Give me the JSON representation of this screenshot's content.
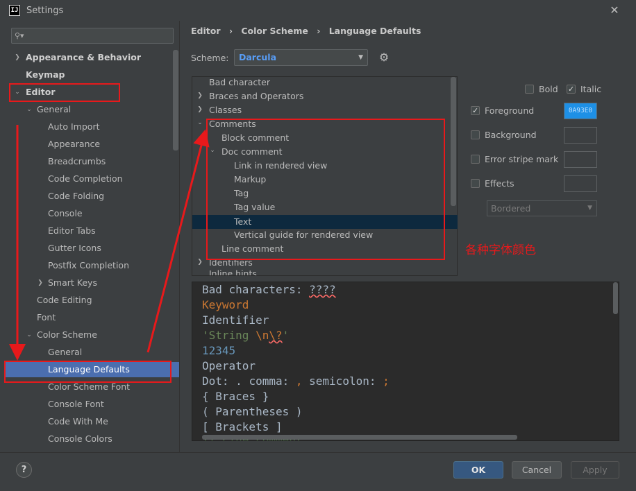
{
  "window": {
    "title": "Settings",
    "app_icon_text": "IJ"
  },
  "search": {
    "placeholder": ""
  },
  "sidebar": {
    "items": [
      {
        "label": "Appearance & Behavior"
      },
      {
        "label": "Keymap"
      },
      {
        "label": "Editor"
      },
      {
        "label": "General"
      },
      {
        "label": "Auto Import"
      },
      {
        "label": "Appearance"
      },
      {
        "label": "Breadcrumbs"
      },
      {
        "label": "Code Completion"
      },
      {
        "label": "Code Folding"
      },
      {
        "label": "Console"
      },
      {
        "label": "Editor Tabs"
      },
      {
        "label": "Gutter Icons"
      },
      {
        "label": "Postfix Completion"
      },
      {
        "label": "Smart Keys"
      },
      {
        "label": "Code Editing"
      },
      {
        "label": "Font"
      },
      {
        "label": "Color Scheme"
      },
      {
        "label": "General"
      },
      {
        "label": "Language Defaults"
      },
      {
        "label": "Color Scheme Font"
      },
      {
        "label": "Console Font"
      },
      {
        "label": "Code With Me"
      },
      {
        "label": "Console Colors"
      }
    ]
  },
  "breadcrumb": [
    "Editor",
    "Color Scheme",
    "Language Defaults"
  ],
  "scheme": {
    "label": "Scheme:",
    "value": "Darcula"
  },
  "elements": [
    {
      "label": "Bad character"
    },
    {
      "label": "Braces and Operators"
    },
    {
      "label": "Classes"
    },
    {
      "label": "Comments"
    },
    {
      "label": "Block comment"
    },
    {
      "label": "Doc comment"
    },
    {
      "label": "Link in rendered view"
    },
    {
      "label": "Markup"
    },
    {
      "label": "Tag"
    },
    {
      "label": "Tag value"
    },
    {
      "label": "Text"
    },
    {
      "label": "Vertical guide for rendered view"
    },
    {
      "label": "Line comment"
    },
    {
      "label": "Identifiers"
    },
    {
      "label": "Inline hints"
    }
  ],
  "attributes": {
    "bold": {
      "label": "Bold",
      "checked": false
    },
    "italic": {
      "label": "Italic",
      "checked": true
    },
    "foreground": {
      "label": "Foreground",
      "checked": true,
      "color": "0A93E0"
    },
    "background": {
      "label": "Background",
      "checked": false
    },
    "error_stripe": {
      "label": "Error stripe mark",
      "checked": false
    },
    "effects": {
      "label": "Effects",
      "checked": false
    },
    "effects_type": "Bordered"
  },
  "preview": {
    "bad_prefix": "Bad characters: ",
    "bad_chars": "????",
    "keyword": "Keyword",
    "identifier": "Identifier",
    "string_open": "'String ",
    "string_escape": "\\n",
    "string_invalid": "\\?",
    "string_close": "'",
    "number": "12345",
    "operator": "Operator",
    "dot_prefix": "Dot: ",
    "dot": ".",
    "comma_prefix": " comma: ",
    "comma": ",",
    "semicolon_prefix": " semicolon: ",
    "semicolon": ";",
    "braces": "{ Braces }",
    "parentheses": "( Parentheses )",
    "brackets": "[ Brackets ]",
    "line_comment": "// Line comment"
  },
  "buttons": {
    "ok": "OK",
    "cancel": "Cancel",
    "apply": "Apply",
    "help": "?"
  },
  "annotation": {
    "text": "各种字体颜色"
  },
  "colors": {
    "selection": "#4b6eaf",
    "accent": "#589df6",
    "annotation": "#e8191b",
    "foreground_swatch": "#1e90e6"
  }
}
